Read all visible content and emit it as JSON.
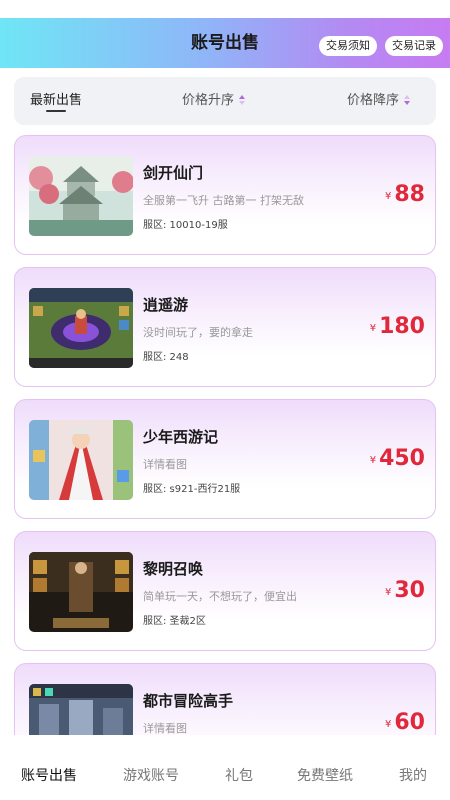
{
  "header": {
    "title": "账号出售",
    "notice_label": "交易须知",
    "records_label": "交易记录"
  },
  "sort": {
    "latest": "最新出售",
    "price_asc": "价格升序",
    "price_desc": "价格降序"
  },
  "listings": [
    {
      "title": "剑开仙门",
      "desc": "全服第一飞升 古路第一 打架无敌",
      "server": "服区: 10010-19服",
      "currency": "¥",
      "price": "88"
    },
    {
      "title": "逍遥游",
      "desc": "没时间玩了，要的拿走",
      "server": "服区: 248",
      "currency": "¥",
      "price": "180"
    },
    {
      "title": "少年西游记",
      "desc": "详情看图",
      "server": "服区: s921-西行21服",
      "currency": "¥",
      "price": "450"
    },
    {
      "title": "黎明召唤",
      "desc": "简单玩一天，不想玩了，便宜出",
      "server": "服区: 圣裁2区",
      "currency": "¥",
      "price": "30"
    },
    {
      "title": "都市冒险高手",
      "desc": "详情看图",
      "server": "",
      "currency": "¥",
      "price": "60"
    }
  ],
  "tabs": [
    "账号出售",
    "游戏账号",
    "礼包",
    "免费壁纸",
    "我的"
  ],
  "colors": {
    "accent_price": "#e0283a",
    "header_gradient_start": "#6fe6f5",
    "header_gradient_end": "#c77cf1",
    "card_border": "#e4c3f0"
  }
}
